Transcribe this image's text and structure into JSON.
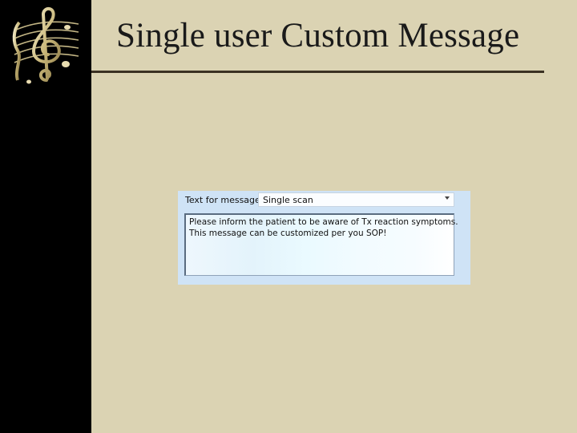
{
  "page": {
    "title": "Single user Custom Message"
  },
  "sidebar": {
    "logo_icon": "treble-clef-icon"
  },
  "message_panel": {
    "label": "Text for message",
    "select_value": "Single scan",
    "message_lines": [
      "Please inform the patient to be aware of Tx reaction symptoms.",
      "This message can be customized per you SOP!"
    ]
  },
  "colors": {
    "background": "#dbd3b3",
    "sidebar": "#000000",
    "panel": "#cfe3f6"
  }
}
